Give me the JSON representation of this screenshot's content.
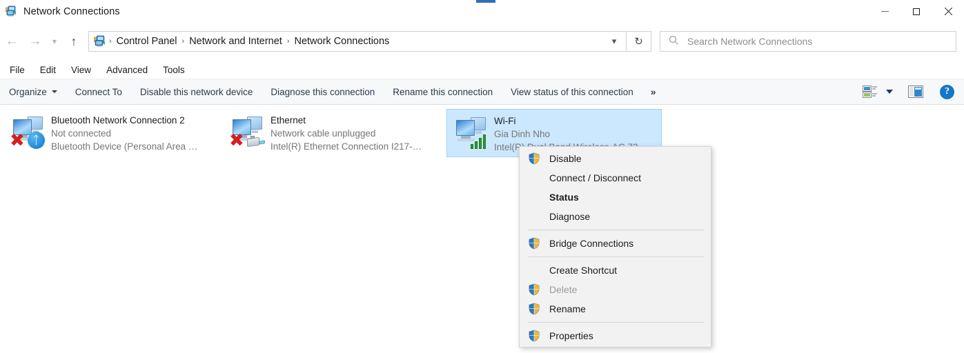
{
  "window": {
    "title": "Network Connections",
    "icon": "network-connections-icon",
    "controls": {
      "minimize": "Minimize",
      "maximize": "Maximize",
      "close": "Close"
    }
  },
  "address_bar": {
    "back": "Back",
    "forward": "Forward",
    "recent": "Recent locations",
    "up": "Up",
    "icon": "control-panel-icon",
    "breadcrumbs": [
      "Control Panel",
      "Network and Internet",
      "Network Connections"
    ],
    "separator": "›",
    "dropdown": "Previous locations",
    "refresh": "Refresh"
  },
  "search": {
    "placeholder": "Search Network Connections",
    "value": "",
    "icon": "search-icon"
  },
  "menu_bar": {
    "items": [
      "File",
      "Edit",
      "View",
      "Advanced",
      "Tools"
    ]
  },
  "command_bar": {
    "items": [
      {
        "label": "Organize",
        "has_caret": true
      },
      {
        "label": "Connect To",
        "has_caret": false
      },
      {
        "label": "Disable this network device",
        "has_caret": false
      },
      {
        "label": "Diagnose this connection",
        "has_caret": false
      },
      {
        "label": "Rename this connection",
        "has_caret": false
      },
      {
        "label": "View status of this connection",
        "has_caret": false
      }
    ],
    "overflow": "»",
    "view_options_icon": "change-view-icon",
    "view_options_caret": "chevron-down-icon",
    "preview_pane_icon": "preview-pane-icon",
    "help_icon": "help-icon",
    "help_glyph": "?"
  },
  "connections": [
    {
      "name": "Bluetooth Network Connection 2",
      "status": "Not connected",
      "device": "Bluetooth Device (Personal Area …",
      "selected": false,
      "badge": "bluetooth-icon",
      "error": true
    },
    {
      "name": "Ethernet",
      "status": "Network cable unplugged",
      "device": "Intel(R) Ethernet Connection I217-…",
      "selected": false,
      "badge": "ethernet-cable-icon",
      "error": true
    },
    {
      "name": "Wi-Fi",
      "status": "Gia Dinh Nho",
      "device": "Intel(R) Dual Band Wireless-AC 72…",
      "selected": true,
      "badge": "wifi-signal-icon",
      "error": false
    }
  ],
  "context_menu": {
    "groups": [
      {
        "items": [
          {
            "label": "Disable",
            "shield": true,
            "bold": false,
            "disabled": false
          },
          {
            "label": "Connect / Disconnect",
            "shield": false,
            "bold": false,
            "disabled": false
          },
          {
            "label": "Status",
            "shield": false,
            "bold": true,
            "disabled": false
          },
          {
            "label": "Diagnose",
            "shield": false,
            "bold": false,
            "disabled": false
          }
        ]
      },
      {
        "items": [
          {
            "label": "Bridge Connections",
            "shield": true,
            "bold": false,
            "disabled": false
          }
        ]
      },
      {
        "items": [
          {
            "label": "Create Shortcut",
            "shield": false,
            "bold": false,
            "disabled": false
          },
          {
            "label": "Delete",
            "shield": true,
            "bold": false,
            "disabled": true
          },
          {
            "label": "Rename",
            "shield": true,
            "bold": false,
            "disabled": false
          }
        ]
      },
      {
        "items": [
          {
            "label": "Properties",
            "shield": true,
            "bold": false,
            "disabled": false
          }
        ]
      }
    ]
  },
  "colors": {
    "selection": "#cce8ff",
    "selection_border": "#9fd1f5",
    "command_bar_bg": "#f7f8fa",
    "command_text": "#2b3a4a",
    "menu_bg": "#f2f2f2",
    "accent": "#1477c8",
    "error_red": "#d32020",
    "wifi_green": "#2e9b2e"
  }
}
